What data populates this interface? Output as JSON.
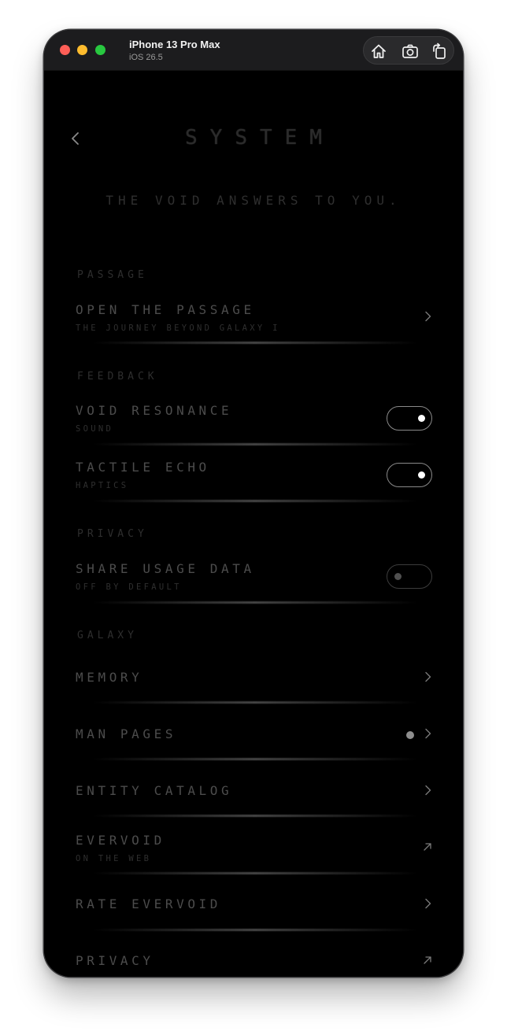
{
  "window": {
    "device_name": "iPhone 13 Pro Max",
    "os_version": "iOS 26.5",
    "toolbar_icons": [
      "home-icon",
      "screenshot-icon",
      "rotate-icon"
    ]
  },
  "header": {
    "back_icon": "chevron-left-icon",
    "title": "SYSTEM",
    "tagline": "THE VOID ANSWERS TO YOU."
  },
  "sections": {
    "passage": "PASSAGE",
    "feedback": "FEEDBACK",
    "privacy": "PRIVACY",
    "galaxy": "GALAXY"
  },
  "rows": {
    "open_passage": {
      "title": "OPEN THE PASSAGE",
      "subtitle": "THE JOURNEY BEYOND GALAXY I"
    },
    "void_resonance": {
      "title": "VOID RESONANCE",
      "subtitle": "SOUND",
      "enabled": true
    },
    "tactile_echo": {
      "title": "TACTILE ECHO",
      "subtitle": "HAPTICS",
      "enabled": true
    },
    "share_usage": {
      "title": "SHARE USAGE DATA",
      "subtitle": "OFF BY DEFAULT",
      "enabled": false
    },
    "memory": {
      "title": "MEMORY"
    },
    "man_pages": {
      "title": "MAN PAGES",
      "has_indicator_dot": true
    },
    "entity_catalog": {
      "title": "ENTITY CATALOG"
    },
    "evervoid_web": {
      "title": "EVERVOID",
      "subtitle": "ON THE WEB"
    },
    "rate_evervoid": {
      "title": "RATE EVERVOID"
    },
    "privacy_link": {
      "title": "PRIVACY"
    }
  },
  "colors": {
    "background": "#000000",
    "text_primary": "#4c4c4c",
    "text_muted": "#2f2f2f",
    "toggle_on_knob": "#ffffff",
    "indicator_dot": "#8e8e8e"
  }
}
